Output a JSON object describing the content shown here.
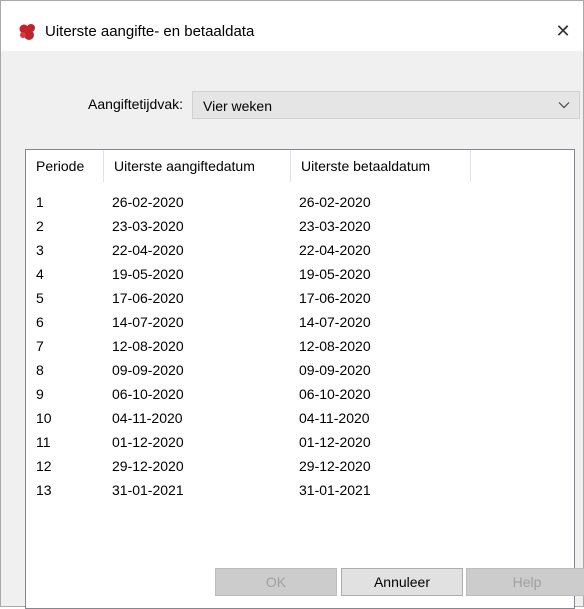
{
  "window": {
    "title": "Uiterste aangifte- en betaaldata",
    "close_glyph": "✕",
    "icon": "app-logo-icon"
  },
  "form": {
    "period_label": "Aangiftetijdvak:",
    "period_value": "Vier weken"
  },
  "table": {
    "headers": [
      "Periode",
      "Uiterste aangiftedatum",
      "Uiterste betaaldatum"
    ],
    "rows": [
      [
        "1",
        "26-02-2020",
        "26-02-2020"
      ],
      [
        "2",
        "23-03-2020",
        "23-03-2020"
      ],
      [
        "3",
        "22-04-2020",
        "22-04-2020"
      ],
      [
        "4",
        "19-05-2020",
        "19-05-2020"
      ],
      [
        "5",
        "17-06-2020",
        "17-06-2020"
      ],
      [
        "6",
        "14-07-2020",
        "14-07-2020"
      ],
      [
        "7",
        "12-08-2020",
        "12-08-2020"
      ],
      [
        "8",
        "09-09-2020",
        "09-09-2020"
      ],
      [
        "9",
        "06-10-2020",
        "06-10-2020"
      ],
      [
        "10",
        "04-11-2020",
        "04-11-2020"
      ],
      [
        "11",
        "01-12-2020",
        "01-12-2020"
      ],
      [
        "12",
        "29-12-2020",
        "29-12-2020"
      ],
      [
        "13",
        "31-01-2021",
        "31-01-2021"
      ]
    ]
  },
  "buttons": {
    "ok": "OK",
    "cancel": "Annuleer",
    "help": "Help"
  },
  "colors": {
    "logo": "#c0252b",
    "combo_bg": "#e5e5e5",
    "disabled_btn": "#cccccc"
  }
}
